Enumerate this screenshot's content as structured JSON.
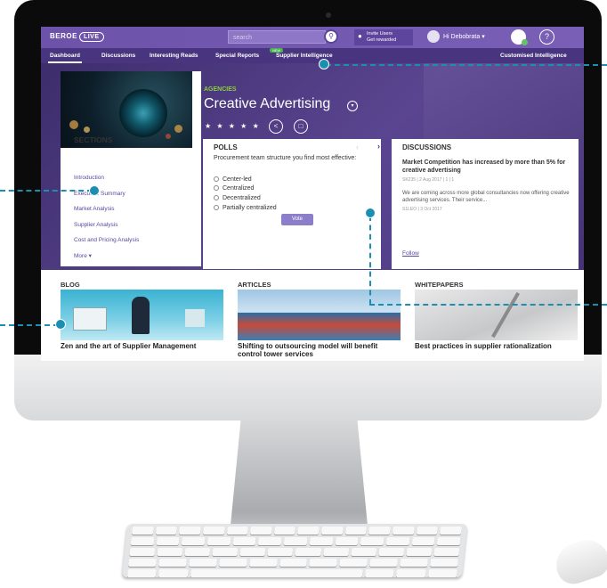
{
  "topbar": {
    "logo": "BEROE",
    "logo_live": "LIVE",
    "search_placeholder": "search",
    "search_icon": "search-icon",
    "invite_line1": "Invite Users",
    "invite_line2": "Get rewarded",
    "user_greeting": "Hi Debobrata",
    "help_glyph": "?"
  },
  "nav": {
    "items": [
      "Dashboard",
      "Discussions",
      "Interesting Reads",
      "Special Reports",
      "Supplier Intelligence"
    ],
    "new_tag": "NEW",
    "right_item": "Customised Intelligence"
  },
  "hero": {
    "category": "AGENCIES",
    "title": "Creative Advertising",
    "stars": "★ ★ ★ ★ ★"
  },
  "sections": {
    "title": "SECTIONS",
    "items": [
      "Introduction",
      "Executive Summary",
      "Market Analysis",
      "Supplier Analysis",
      "Cost and Pricing Analysis",
      "More ▾"
    ]
  },
  "polls": {
    "title": "POLLS",
    "question": "Procurement team structure you find most effective:",
    "options": [
      "Center-led",
      "Centralized",
      "Decentralized",
      "Partially centralized"
    ],
    "vote_label": "Vote"
  },
  "discussions": {
    "title": "DISCUSSIONS",
    "headline": "Market Competition has increased by more than 5% for creative advertising",
    "meta1": "SK235 | 2 Aug 2017 | 1 | 1",
    "body": "We are coming across more global consultancies now offering creative advertising services. Their service...",
    "meta2": "S1LEO | 3 Oct 2017",
    "follow": "Follow"
  },
  "content": {
    "blog": {
      "title": "BLOG",
      "caption": "Zen and the art of Supplier Management"
    },
    "articles": {
      "title": "ARTICLES",
      "caption": "Shifting to outsourcing model will benefit control tower services"
    },
    "whitepapers": {
      "title": "WHITEPAPERS",
      "caption": "Best practices in supplier rationalization"
    }
  },
  "colors": {
    "brand_purple": "#6c52a8",
    "nav_purple": "#49357f",
    "accent_green": "#8bd03b",
    "callout_teal": "#1b8fb0"
  }
}
